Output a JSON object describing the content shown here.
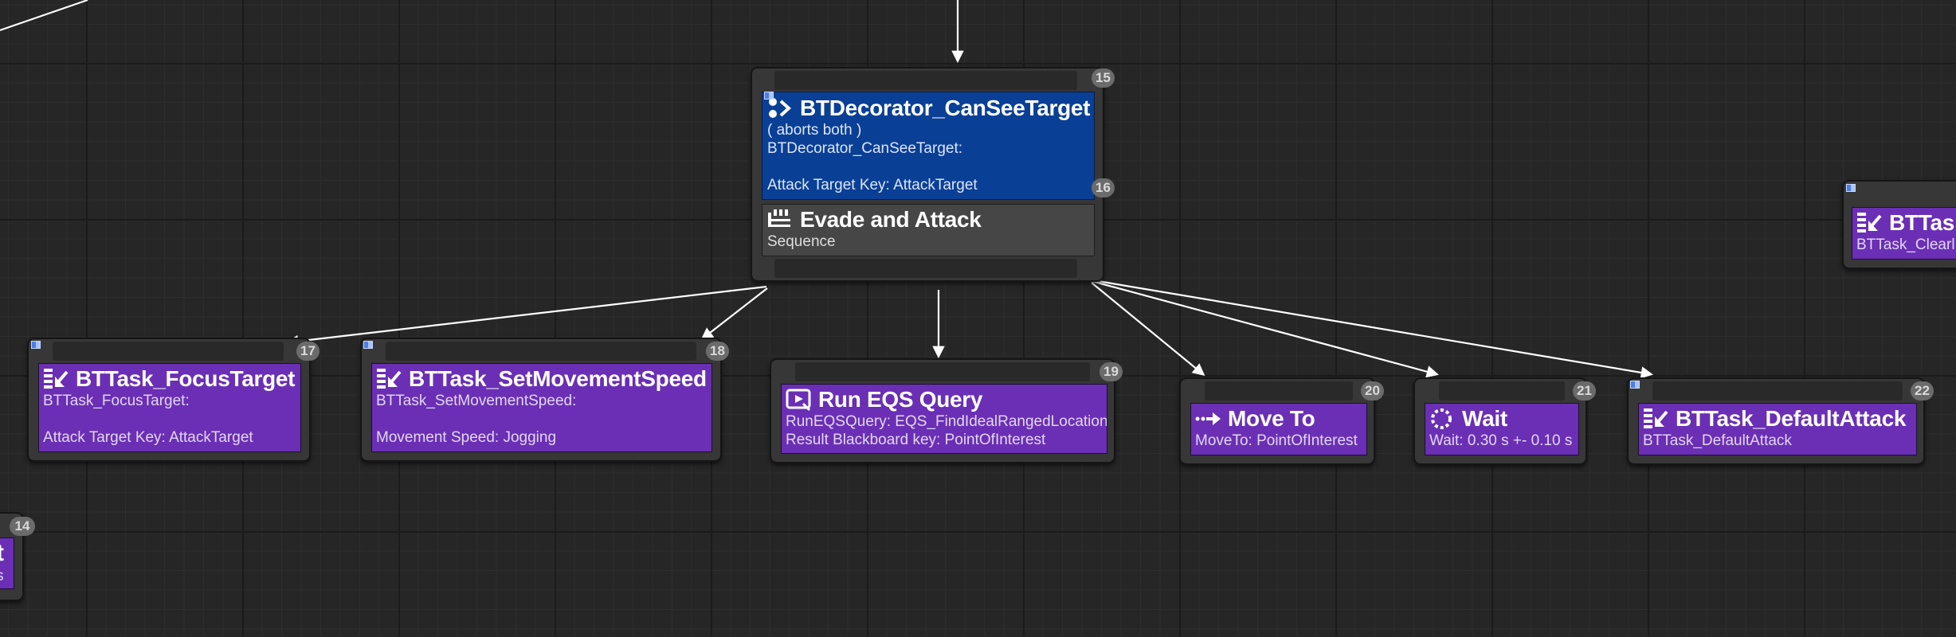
{
  "nodes": {
    "evade": {
      "index": "15",
      "decorator_index": "16",
      "decorator": {
        "title": "BTDecorator_CanSeeTarget",
        "abort_mode": "( aborts both )",
        "class_line": "BTDecorator_CanSeeTarget:",
        "key_line": "Attack Target Key: AttackTarget"
      },
      "title": "Evade and Attack",
      "type": "Sequence"
    },
    "focus_target": {
      "index": "17",
      "title": "BTTask_FocusTarget",
      "class_line": "BTTask_FocusTarget:",
      "detail": "Attack Target Key: AttackTarget"
    },
    "set_movement_speed": {
      "index": "18",
      "title": "BTTask_SetMovementSpeed",
      "class_line": "BTTask_SetMovementSpeed:",
      "detail": "Movement Speed: Jogging"
    },
    "run_eqs": {
      "index": "19",
      "title": "Run EQS Query",
      "query_line": "RunEQSQuery: EQS_FindIdealRangedLocation",
      "result_line": "Result Blackboard key: PointOfInterest"
    },
    "move_to": {
      "index": "20",
      "title": "Move To",
      "detail": "MoveTo: PointOfInterest"
    },
    "wait": {
      "index": "21",
      "title": "Wait",
      "detail": "Wait: 0.30 s +- 0.10 s"
    },
    "default_attack": {
      "index": "22",
      "title": "BTTask_DefaultAttack",
      "detail": "BTTask_DefaultAttack"
    },
    "partial_right": {
      "title": "BTTas",
      "detail": "BTTask_Clearl"
    },
    "partial_left": {
      "index": "14",
      "title": "t",
      "detail": "s"
    }
  },
  "icons": {
    "decorator": "decorator-icon",
    "sequence": "sequence-icon",
    "blueprint_task": "blueprint-task-icon",
    "eqs": "eqs-query-icon",
    "move_to": "move-to-icon",
    "wait": "wait-icon",
    "blueprint_flag": "blueprint-flag-icon"
  },
  "colors": {
    "graph_background": "#262626",
    "task_purple": "#6a2fb4",
    "decorator_blue": "#0a3f96",
    "composite_gray": "#464646",
    "wire_white": "#ffffff",
    "index_badge": "#6b6b6b"
  }
}
